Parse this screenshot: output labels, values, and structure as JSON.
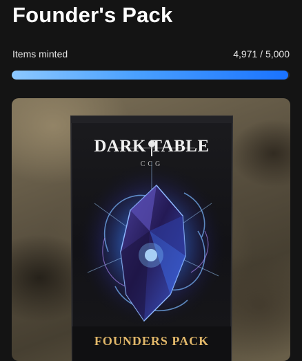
{
  "page": {
    "title": "Founder's Pack"
  },
  "mint": {
    "label": "Items minted",
    "count_text": "4,971 / 5,000",
    "minted": 4971,
    "total": 5000
  },
  "pack": {
    "brand": "DARK TABLE",
    "brand_sub": "CCG",
    "label": "FOUNDERS PACK"
  },
  "colors": {
    "progress_start": "#8cc8ff",
    "progress_end": "#1a73ff",
    "pack_label": "#e2b86a"
  }
}
